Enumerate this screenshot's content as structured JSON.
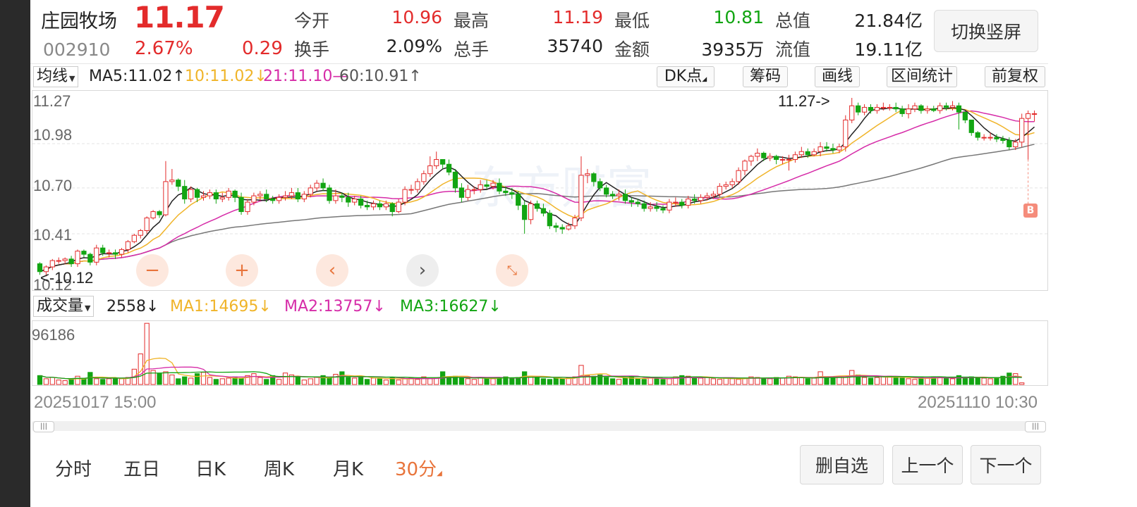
{
  "stock": {
    "name": "庄园牧场",
    "code": "002910",
    "price": "11.17",
    "pct": "2.67%",
    "change": "0.29"
  },
  "quote": {
    "open_label": "今开",
    "open": "10.96",
    "high_label": "最高",
    "high": "11.19",
    "low_label": "最低",
    "low": "10.81",
    "total_label": "总值",
    "total": "21.84亿",
    "turnover_label": "换手",
    "turnover": "2.09%",
    "volume_label": "总手",
    "volume": "35740",
    "amount_label": "金额",
    "amount": "3935万",
    "float_label": "流值",
    "float": "19.11亿"
  },
  "switch_button": "切换竖屏",
  "ma_bar": {
    "dropdown": "均线",
    "ma5": "MA5:11.02↑",
    "ma10": "10:11.02↓",
    "ma21": "21:11.10—",
    "ma60": "60:10.91↑"
  },
  "tools": {
    "dk": "DK点",
    "chips": "筹码",
    "draw": "画线",
    "range": "区间统计",
    "rights": "前复权"
  },
  "price_axis": [
    "11.27",
    "10.98",
    "10.70",
    "10.41",
    "10.12"
  ],
  "annotations": {
    "max": "11.27->",
    "min": "<-10.12",
    "buy": "B"
  },
  "vol_bar": {
    "dropdown": "成交量",
    "vol": "2558↓",
    "ma1": "MA1:14695↓",
    "ma2": "MA2:13757↓",
    "ma3": "MA3:16627↓"
  },
  "vol_axis": "96186",
  "dates": {
    "start": "20251017 15:00",
    "end": "20251110 10:30"
  },
  "periods": [
    "分时",
    "五日",
    "日K",
    "周K",
    "月K",
    "30分"
  ],
  "bottom_buttons": {
    "remove": "删自选",
    "prev": "上一个",
    "next": "下一个"
  },
  "colors": {
    "up": "#e32b2b",
    "down": "#12a512",
    "ma5": "#222222",
    "ma10": "#f0b429",
    "ma21": "#d62ca8",
    "ma60": "#777777",
    "accent": "#e8743b"
  },
  "chart_data": {
    "type": "candlestick",
    "ylim": [
      10.12,
      11.27
    ],
    "open": [
      10.22,
      10.17,
      10.2,
      10.24,
      10.24,
      10.25,
      10.22,
      10.3,
      10.28,
      10.23,
      10.32,
      10.29,
      10.29,
      10.28,
      10.31,
      10.36,
      10.4,
      10.43,
      10.51,
      10.55,
      10.53,
      10.74,
      10.75,
      10.71,
      10.63,
      10.69,
      10.64,
      10.65,
      10.67,
      10.63,
      10.64,
      10.68,
      10.64,
      10.55,
      10.61,
      10.65,
      10.66,
      10.63,
      10.62,
      10.64,
      10.65,
      10.67,
      10.63,
      10.66,
      10.7,
      10.73,
      10.7,
      10.62,
      10.65,
      10.64,
      10.61,
      10.63,
      10.59,
      10.58,
      10.6,
      10.58,
      10.6,
      10.55,
      10.61,
      10.69,
      10.69,
      10.74,
      10.79,
      10.84,
      10.88,
      10.85,
      10.8,
      10.7,
      10.64,
      10.69,
      10.69,
      10.72,
      10.71,
      10.73,
      10.68,
      10.67,
      10.66,
      10.59,
      10.5,
      10.6,
      10.57,
      10.54,
      10.46,
      10.45,
      10.44,
      10.46,
      10.51,
      10.78,
      10.79,
      10.74,
      10.7,
      10.66,
      10.65,
      10.66,
      10.62,
      10.61,
      10.6,
      10.57,
      10.58,
      10.57,
      10.56,
      10.61,
      10.61,
      10.59,
      10.63,
      10.62,
      10.64,
      10.65,
      10.66,
      10.71,
      10.72,
      10.74,
      10.81,
      10.87,
      10.9,
      10.92,
      10.89,
      10.9,
      10.88,
      10.88,
      10.88,
      10.91,
      10.93,
      10.91,
      10.93,
      10.96,
      10.95,
      10.94,
      10.96,
      11.13,
      11.22,
      11.18,
      11.21,
      11.19,
      11.21,
      11.21,
      11.21,
      11.2,
      11.17,
      11.2,
      11.22,
      11.19,
      11.2,
      11.19,
      11.22,
      11.21,
      11.22,
      11.18,
      11.13,
      11.05,
      11.02,
      11.02,
      11.02,
      11.01,
      11.0,
      10.96,
      10.99,
      11.14,
      11.17
    ],
    "close": [
      10.17,
      10.2,
      10.24,
      10.24,
      10.25,
      10.22,
      10.3,
      10.28,
      10.23,
      10.32,
      10.29,
      10.29,
      10.28,
      10.31,
      10.36,
      10.4,
      10.43,
      10.51,
      10.55,
      10.53,
      10.74,
      10.75,
      10.71,
      10.63,
      10.69,
      10.64,
      10.65,
      10.67,
      10.63,
      10.64,
      10.68,
      10.64,
      10.55,
      10.61,
      10.65,
      10.66,
      10.63,
      10.62,
      10.64,
      10.65,
      10.67,
      10.63,
      10.66,
      10.7,
      10.73,
      10.7,
      10.62,
      10.65,
      10.64,
      10.61,
      10.63,
      10.59,
      10.58,
      10.6,
      10.58,
      10.6,
      10.55,
      10.61,
      10.69,
      10.69,
      10.74,
      10.79,
      10.84,
      10.88,
      10.85,
      10.8,
      10.7,
      10.64,
      10.69,
      10.69,
      10.72,
      10.71,
      10.73,
      10.68,
      10.67,
      10.66,
      10.59,
      10.5,
      10.6,
      10.57,
      10.54,
      10.46,
      10.45,
      10.44,
      10.46,
      10.51,
      10.78,
      10.79,
      10.74,
      10.7,
      10.66,
      10.65,
      10.66,
      10.62,
      10.61,
      10.6,
      10.57,
      10.58,
      10.57,
      10.56,
      10.61,
      10.61,
      10.59,
      10.63,
      10.62,
      10.64,
      10.65,
      10.66,
      10.71,
      10.72,
      10.74,
      10.81,
      10.87,
      10.9,
      10.92,
      10.89,
      10.9,
      10.88,
      10.88,
      10.88,
      10.91,
      10.93,
      10.91,
      10.93,
      10.96,
      10.95,
      10.94,
      10.96,
      11.13,
      11.22,
      11.18,
      11.21,
      11.19,
      11.21,
      11.21,
      11.21,
      11.2,
      11.17,
      11.2,
      11.22,
      11.19,
      11.2,
      11.19,
      11.22,
      11.21,
      11.22,
      11.18,
      11.13,
      11.05,
      11.02,
      11.02,
      11.02,
      11.01,
      11.0,
      10.96,
      10.99,
      11.14,
      11.17,
      11.17
    ],
    "high": [
      10.23,
      10.21,
      10.25,
      10.26,
      10.26,
      10.27,
      10.31,
      10.31,
      10.29,
      10.34,
      10.34,
      10.31,
      10.31,
      10.32,
      10.37,
      10.41,
      10.44,
      10.52,
      10.56,
      10.56,
      10.87,
      10.82,
      10.76,
      10.75,
      10.71,
      10.7,
      10.68,
      10.69,
      10.69,
      10.67,
      10.7,
      10.69,
      10.67,
      10.63,
      10.67,
      10.68,
      10.69,
      10.65,
      10.66,
      10.68,
      10.7,
      10.7,
      10.68,
      10.72,
      10.75,
      10.76,
      10.72,
      10.69,
      10.67,
      10.67,
      10.65,
      10.65,
      10.62,
      10.62,
      10.62,
      10.62,
      10.61,
      10.63,
      10.71,
      10.72,
      10.76,
      10.81,
      10.9,
      10.93,
      10.88,
      10.88,
      10.82,
      10.73,
      10.72,
      10.71,
      10.75,
      10.75,
      10.75,
      10.76,
      10.71,
      10.7,
      10.68,
      10.62,
      10.62,
      10.62,
      10.6,
      10.56,
      10.48,
      10.47,
      10.48,
      10.53,
      10.9,
      10.82,
      10.8,
      10.76,
      10.72,
      10.68,
      10.69,
      10.69,
      10.64,
      10.63,
      10.62,
      10.61,
      10.61,
      10.59,
      10.63,
      10.64,
      10.63,
      10.65,
      10.66,
      10.66,
      10.67,
      10.68,
      10.73,
      10.74,
      10.76,
      10.83,
      10.88,
      10.91,
      10.95,
      10.93,
      10.92,
      10.91,
      10.9,
      10.91,
      10.93,
      10.96,
      10.95,
      10.95,
      10.99,
      10.99,
      10.98,
      10.98,
      11.16,
      11.27,
      11.24,
      11.23,
      11.23,
      11.23,
      11.24,
      11.23,
      11.24,
      11.22,
      11.23,
      11.24,
      11.23,
      11.22,
      11.22,
      11.24,
      11.24,
      11.25,
      11.24,
      11.17,
      11.09,
      11.06,
      11.04,
      11.05,
      11.04,
      11.03,
      11.02,
      11.01,
      11.17,
      11.19,
      11.19
    ],
    "low": [
      10.15,
      10.14,
      10.18,
      10.22,
      10.22,
      10.2,
      10.2,
      10.26,
      10.21,
      10.21,
      10.27,
      10.26,
      10.25,
      10.26,
      10.29,
      10.35,
      10.38,
      10.41,
      10.5,
      10.51,
      10.52,
      10.72,
      10.68,
      10.6,
      10.61,
      10.61,
      10.62,
      10.63,
      10.6,
      10.61,
      10.62,
      10.61,
      10.53,
      10.53,
      10.59,
      10.62,
      10.61,
      10.6,
      10.6,
      10.62,
      10.63,
      10.61,
      10.61,
      10.64,
      10.68,
      10.68,
      10.6,
      10.6,
      10.61,
      10.58,
      10.59,
      10.57,
      10.56,
      10.56,
      10.56,
      10.56,
      10.52,
      10.54,
      10.59,
      10.66,
      10.67,
      10.72,
      10.77,
      10.82,
      10.82,
      10.78,
      10.67,
      10.61,
      10.62,
      10.66,
      10.67,
      10.69,
      10.69,
      10.66,
      10.65,
      10.63,
      10.56,
      10.41,
      10.47,
      10.55,
      10.52,
      10.44,
      10.42,
      10.41,
      10.43,
      10.44,
      10.49,
      10.73,
      10.71,
      10.68,
      10.64,
      10.63,
      10.62,
      10.6,
      10.58,
      10.58,
      10.55,
      10.55,
      10.55,
      10.54,
      10.54,
      10.58,
      10.57,
      10.57,
      10.6,
      10.6,
      10.62,
      10.63,
      10.64,
      10.69,
      10.7,
      10.72,
      10.78,
      10.84,
      10.87,
      10.87,
      10.87,
      10.85,
      10.85,
      10.81,
      10.86,
      10.89,
      10.89,
      10.9,
      10.9,
      10.93,
      10.92,
      10.92,
      10.93,
      11.11,
      11.16,
      11.16,
      11.17,
      11.17,
      11.19,
      11.19,
      11.18,
      11.15,
      11.14,
      11.18,
      11.17,
      11.17,
      11.18,
      11.17,
      11.19,
      11.19,
      11.07,
      11.11,
      11.03,
      11.0,
      11.0,
      11.0,
      10.99,
      10.98,
      10.94,
      10.94,
      10.96,
      10.88,
      11.12
    ],
    "volume": [
      14000,
      9000,
      11000,
      7000,
      6000,
      8000,
      13000,
      9000,
      19000,
      9000,
      8000,
      9000,
      10000,
      9000,
      11000,
      24000,
      48000,
      96000,
      22000,
      17000,
      20000,
      15000,
      9000,
      12000,
      10000,
      17000,
      19000,
      11000,
      8000,
      9000,
      10000,
      12000,
      10000,
      14000,
      17000,
      11000,
      8000,
      14000,
      8000,
      18000,
      15000,
      12000,
      7000,
      9000,
      12000,
      14000,
      10000,
      16000,
      20000,
      11000,
      10000,
      12000,
      8000,
      10000,
      10000,
      7000,
      11000,
      7000,
      9000,
      10000,
      8000,
      12000,
      9000,
      10000,
      20000,
      12000,
      13000,
      10000,
      9000,
      8000,
      11000,
      10000,
      9000,
      11000,
      12000,
      10000,
      11000,
      20000,
      13000,
      11000,
      9000,
      8000,
      10000,
      9000,
      10000,
      12000,
      30000,
      14000,
      13000,
      15000,
      11000,
      9000,
      8000,
      10000,
      12000,
      9000,
      8000,
      11000,
      10000,
      8000,
      9000,
      12000,
      14000,
      13000,
      12000,
      10000,
      11000,
      9000,
      8000,
      10000,
      9000,
      8000,
      10000,
      12000,
      11000,
      10000,
      9000,
      11000,
      10000,
      13000,
      12000,
      11000,
      9000,
      10000,
      20000,
      12000,
      12000,
      13000,
      11000,
      22000,
      15000,
      11000,
      10000,
      11000,
      12000,
      13000,
      11000,
      10000,
      9000,
      8000,
      11000,
      10000,
      12000,
      11000,
      10000,
      9000,
      14000,
      11000,
      12000,
      11000,
      10000,
      9000,
      10000,
      13000,
      18000,
      17000,
      2558
    ]
  }
}
